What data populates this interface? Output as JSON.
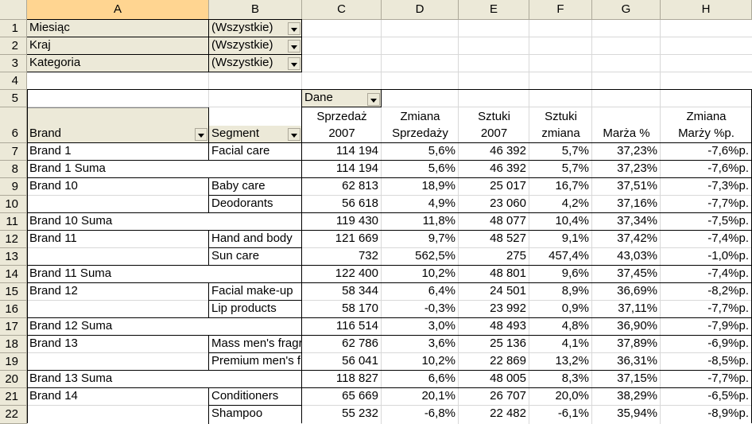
{
  "columns": [
    "A",
    "B",
    "C",
    "D",
    "E",
    "F",
    "G",
    "H"
  ],
  "row_numbers": [
    "1",
    "2",
    "3",
    "4",
    "5",
    "6",
    "7",
    "8",
    "9",
    "10",
    "11",
    "12",
    "13",
    "14",
    "15",
    "16",
    "17",
    "18",
    "19",
    "20",
    "21",
    "22"
  ],
  "page_filters": [
    {
      "label": "Miesiąc",
      "value": "(Wszystkie)"
    },
    {
      "label": "Kraj",
      "value": "(Wszystkie)"
    },
    {
      "label": "Kategoria",
      "value": "(Wszystkie)"
    }
  ],
  "data_field_label": "Dane",
  "header": {
    "brand": "Brand",
    "segment": "Segment",
    "c": [
      "Sprzedaż",
      "2007"
    ],
    "d": [
      "Zmiana",
      "Sprzedaży"
    ],
    "e": [
      "Sztuki",
      "2007"
    ],
    "f": [
      "Sztuki",
      "zmiana"
    ],
    "g": [
      "",
      "Marża %"
    ],
    "h": [
      "Zmiana",
      "Marży %p."
    ]
  },
  "rows": [
    {
      "a": "Brand 1",
      "b": "Facial care",
      "c": "114 194",
      "d": "5,6%",
      "e": "46 392",
      "f": "5,7%",
      "g": "37,23%",
      "h": "-7,6%p."
    },
    {
      "a": "Brand 1 Suma",
      "b": "",
      "c": "114 194",
      "d": "5,6%",
      "e": "46 392",
      "f": "5,7%",
      "g": "37,23%",
      "h": "-7,6%p."
    },
    {
      "a": "Brand 10",
      "b": "Baby care",
      "c": "62 813",
      "d": "18,9%",
      "e": "25 017",
      "f": "16,7%",
      "g": "37,51%",
      "h": "-7,3%p."
    },
    {
      "a": "",
      "b": "Deodorants",
      "c": "56 618",
      "d": "4,9%",
      "e": "23 060",
      "f": "4,2%",
      "g": "37,16%",
      "h": "-7,7%p."
    },
    {
      "a": "Brand 10 Suma",
      "b": "",
      "c": "119 430",
      "d": "11,8%",
      "e": "48 077",
      "f": "10,4%",
      "g": "37,34%",
      "h": "-7,5%p."
    },
    {
      "a": "Brand 11",
      "b": "Hand and body",
      "c": "121 669",
      "d": "9,7%",
      "e": "48 527",
      "f": "9,1%",
      "g": "37,42%",
      "h": "-7,4%p."
    },
    {
      "a": "",
      "b": "Sun care",
      "c": "732",
      "d": "562,5%",
      "e": "275",
      "f": "457,4%",
      "g": "43,03%",
      "h": "-1,0%p."
    },
    {
      "a": "Brand 11 Suma",
      "b": "",
      "c": "122 400",
      "d": "10,2%",
      "e": "48 801",
      "f": "9,6%",
      "g": "37,45%",
      "h": "-7,4%p."
    },
    {
      "a": "Brand 12",
      "b": "Facial make-up",
      "c": "58 344",
      "d": "6,4%",
      "e": "24 501",
      "f": "8,9%",
      "g": "36,69%",
      "h": "-8,2%p."
    },
    {
      "a": "",
      "b": "Lip products",
      "c": "58 170",
      "d": "-0,3%",
      "e": "23 992",
      "f": "0,9%",
      "g": "37,11%",
      "h": "-7,7%p."
    },
    {
      "a": "Brand 12 Suma",
      "b": "",
      "c": "116 514",
      "d": "3,0%",
      "e": "48 493",
      "f": "4,8%",
      "g": "36,90%",
      "h": "-7,9%p."
    },
    {
      "a": "Brand 13",
      "b": "Mass men's fragrances",
      "c": "62 786",
      "d": "3,6%",
      "e": "25 136",
      "f": "4,1%",
      "g": "37,89%",
      "h": "-6,9%p."
    },
    {
      "a": "",
      "b": "Premium men's fragrances",
      "c": "56 041",
      "d": "10,2%",
      "e": "22 869",
      "f": "13,2%",
      "g": "36,31%",
      "h": "-8,5%p."
    },
    {
      "a": "Brand 13 Suma",
      "b": "",
      "c": "118 827",
      "d": "6,6%",
      "e": "48 005",
      "f": "8,3%",
      "g": "37,15%",
      "h": "-7,7%p."
    },
    {
      "a": "Brand 14",
      "b": "Conditioners",
      "c": "65 669",
      "d": "20,1%",
      "e": "26 707",
      "f": "20,0%",
      "g": "38,29%",
      "h": "-6,5%p."
    },
    {
      "a": "",
      "b": "Shampoo",
      "c": "55 232",
      "d": "-6,8%",
      "e": "22 482",
      "f": "-6,1%",
      "g": "35,94%",
      "h": "-8,9%p."
    }
  ],
  "colors": {
    "header_bg": "#ece9d8",
    "selected_header": "#ffd591",
    "filter_bg": "#ece9d8",
    "gridline": "#d8d8d8"
  }
}
